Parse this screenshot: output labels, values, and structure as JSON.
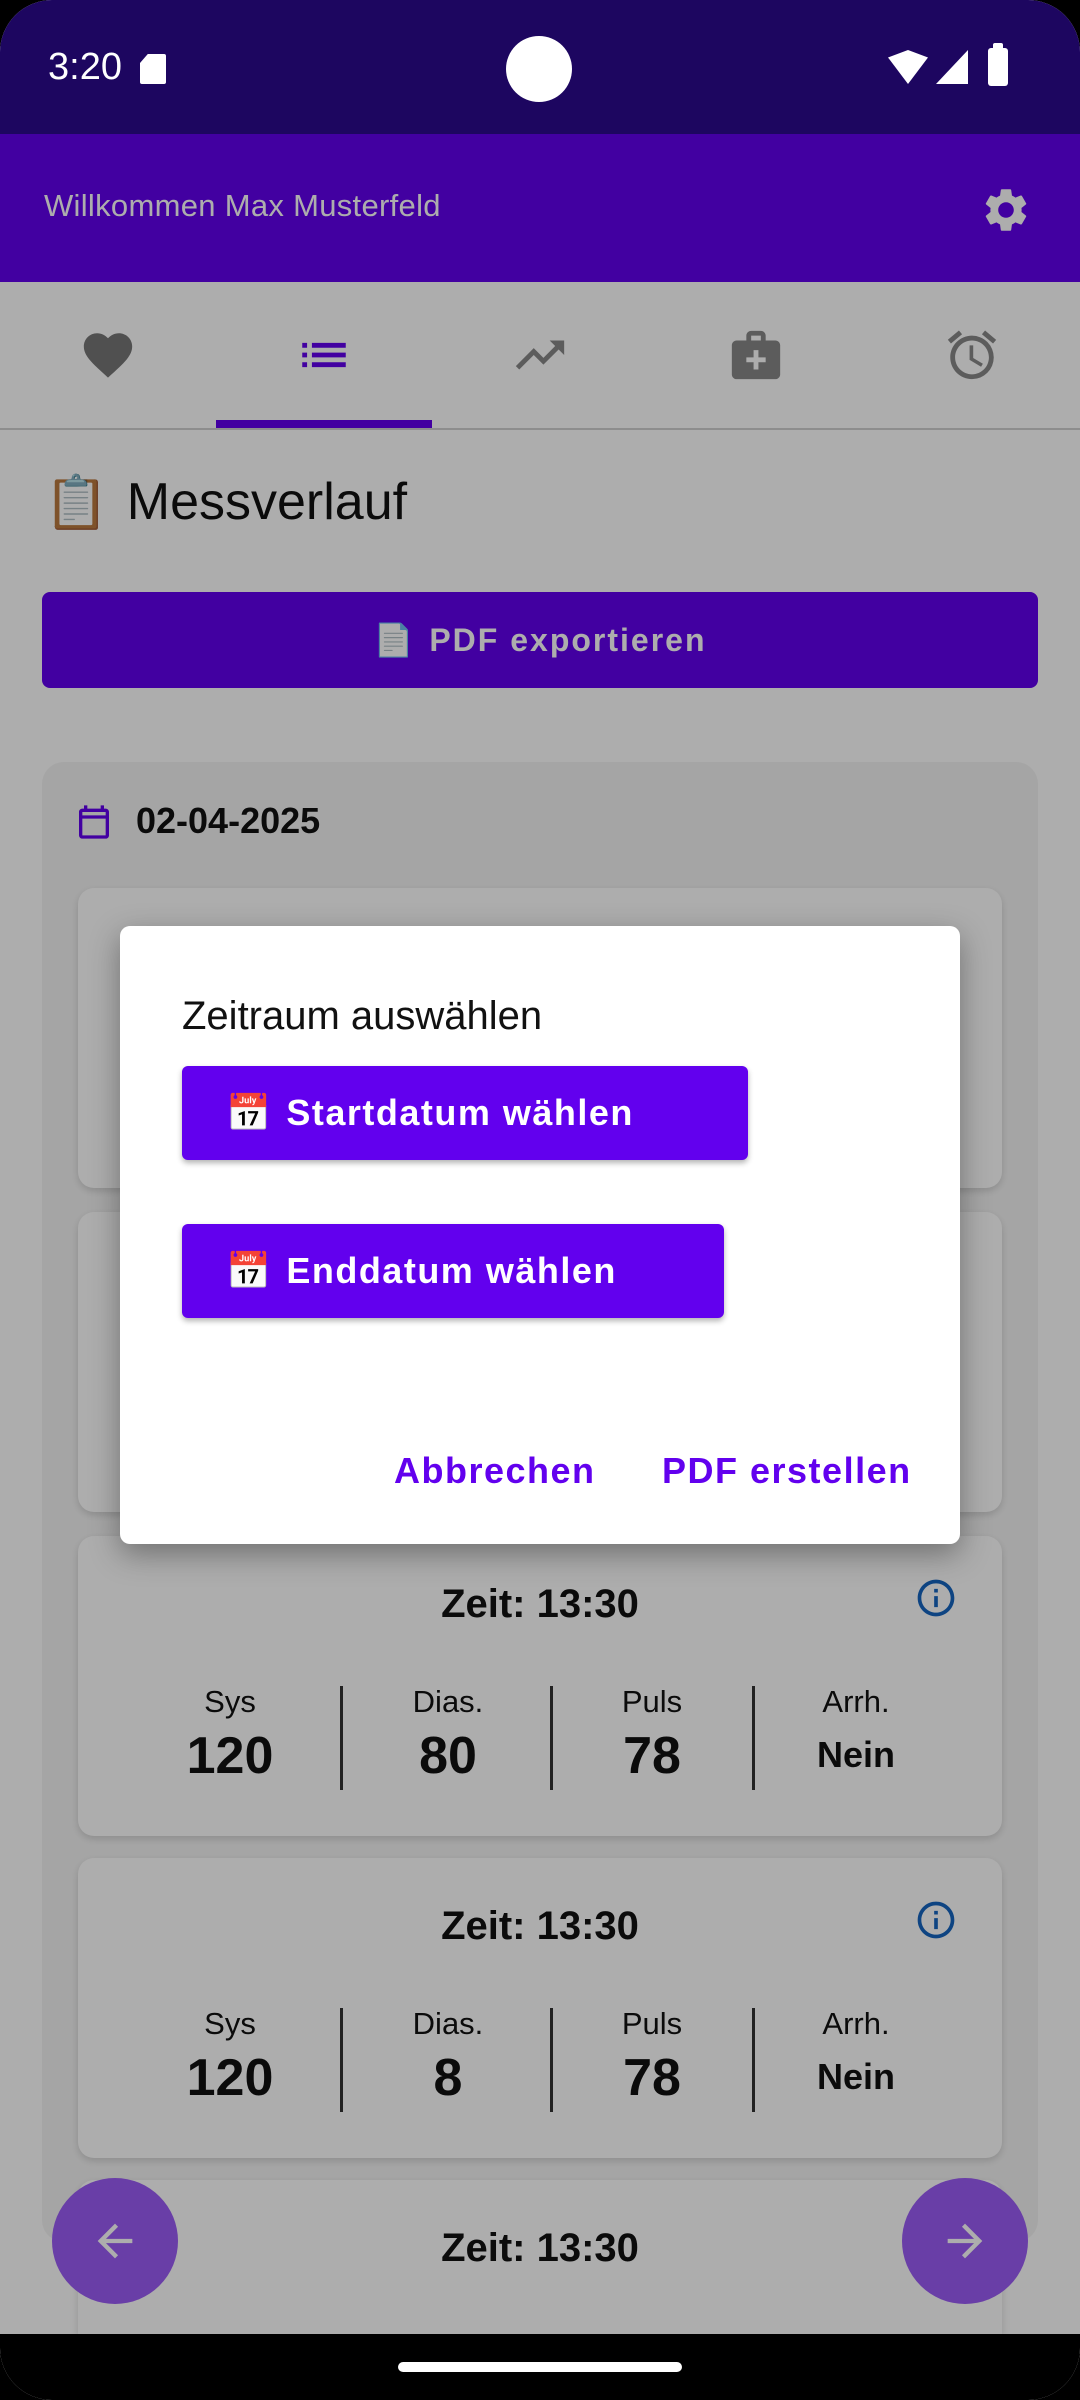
{
  "status_bar": {
    "time": "3:20"
  },
  "app_bar": {
    "welcome": "Willkommen Max Musterfeld"
  },
  "tabs": [
    "heart-icon",
    "list-icon",
    "trending-up-icon",
    "medical-kit-icon",
    "alarm-icon"
  ],
  "page": {
    "title_emoji": "📋",
    "title": "Messverlauf"
  },
  "export_button": {
    "emoji": "📄",
    "label": "PDF exportieren"
  },
  "day": {
    "date": "02-04-2025",
    "entries": [
      {
        "time": "Zeit: 13:30",
        "sys": "120",
        "dias": "80",
        "puls": "78",
        "arrh": "Nein"
      },
      {
        "time": "Zeit: 13:30",
        "sys": "120",
        "dias": "8",
        "puls": "78",
        "arrh": "Nein"
      },
      {
        "time": "Zeit: 13:30"
      }
    ],
    "labels": {
      "sys": "Sys",
      "dias": "Dias.",
      "puls": "Puls",
      "arrh": "Arrh."
    }
  },
  "dialog": {
    "title": "Zeitraum auswählen",
    "start_emoji": "📅",
    "start_label": "Startdatum wählen",
    "end_emoji": "📅",
    "end_label": "Enddatum wählen",
    "cancel": "Abbrechen",
    "confirm": "PDF erstellen"
  },
  "colors": {
    "primary": "#6200ee",
    "status_bar": "#1d0660",
    "fab": "#9b5cf6",
    "info": "#1565c0"
  }
}
